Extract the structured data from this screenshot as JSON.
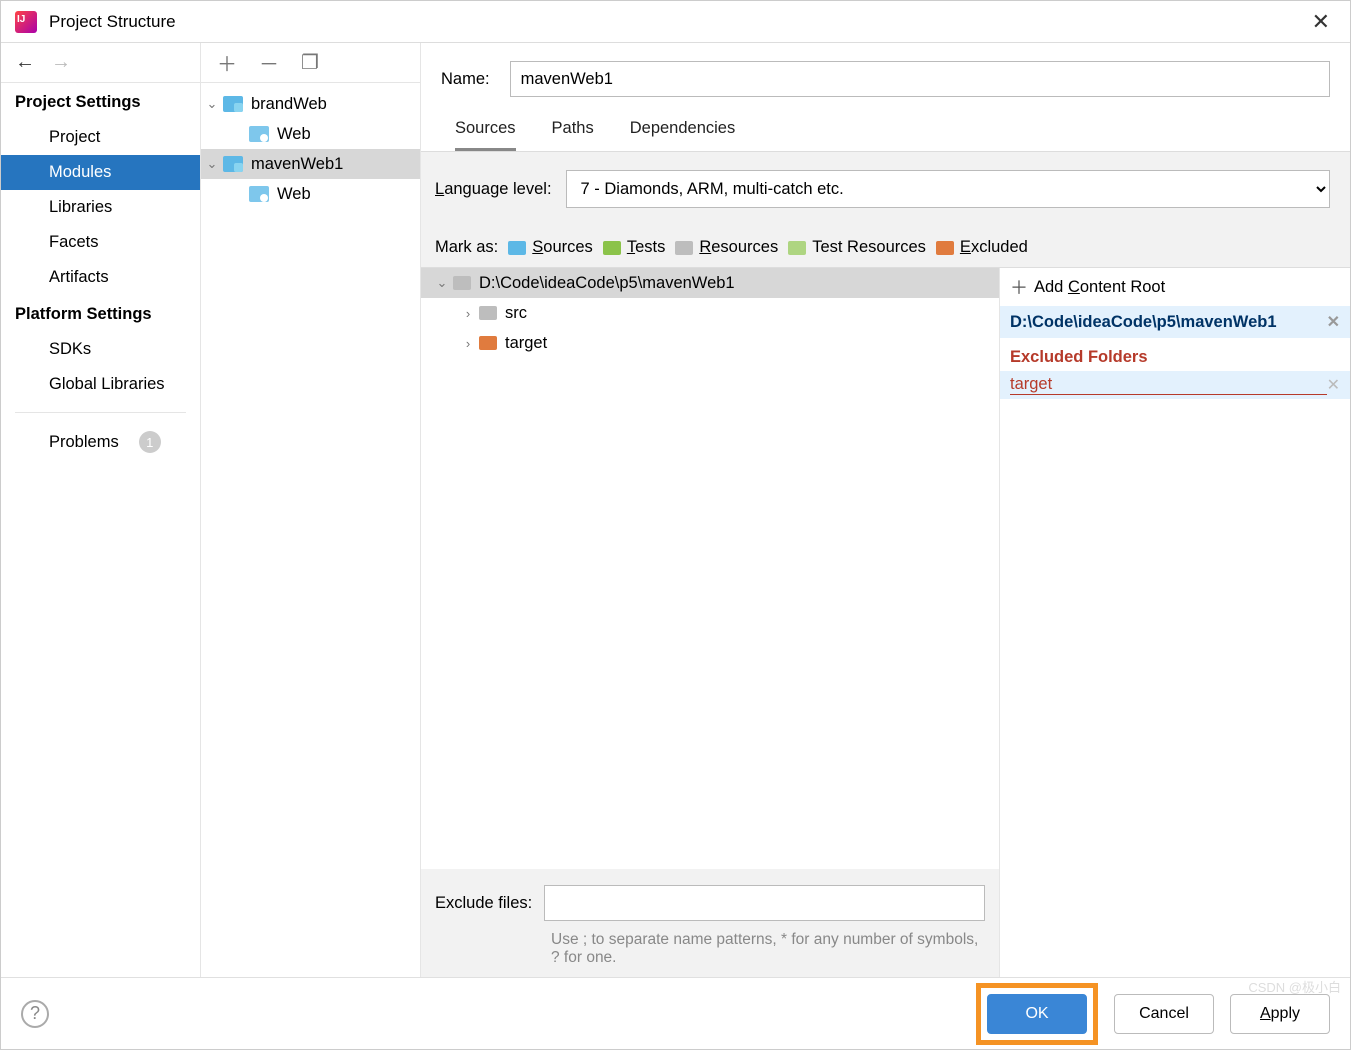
{
  "window": {
    "title": "Project Structure"
  },
  "leftnav": {
    "section1": "Project Settings",
    "items1": [
      "Project",
      "Modules",
      "Libraries",
      "Facets",
      "Artifacts"
    ],
    "section2": "Platform Settings",
    "items2": [
      "SDKs",
      "Global Libraries"
    ],
    "problems": "Problems",
    "problems_count": "1"
  },
  "tree": {
    "modules": [
      {
        "name": "brandWeb",
        "children": [
          "Web"
        ]
      },
      {
        "name": "mavenWeb1",
        "children": [
          "Web"
        ]
      }
    ]
  },
  "content": {
    "name_label": "Name:",
    "name_value": "mavenWeb1",
    "tabs": [
      "Sources",
      "Paths",
      "Dependencies"
    ],
    "lang_label_pre": "L",
    "lang_label_post": "anguage level:",
    "lang_value": "7 - Diamonds, ARM, multi-catch etc.",
    "markas_label": "Mark as:",
    "marks": {
      "sources_pre": "S",
      "sources_post": "ources",
      "tests_pre": "T",
      "tests_post": "ests",
      "resources_pre": "R",
      "resources_post": "esources",
      "tresources": "Test Resources",
      "excluded_pre": "E",
      "excluded_post": "xcluded"
    },
    "root_path": "D:\\Code\\ideaCode\\p5\\mavenWeb1",
    "src_children": [
      {
        "name": "src",
        "color": "gray"
      },
      {
        "name": "target",
        "color": "orange"
      }
    ],
    "exclude_files_label": "Exclude files:",
    "exclude_hint": "Use ; to separate name patterns, * for any number of symbols, ? for one.",
    "right": {
      "add_root_pre": "Add ",
      "add_root_u": "C",
      "add_root_post": "ontent Root",
      "root": "D:\\Code\\ideaCode\\p5\\mavenWeb1",
      "excluded_header": "Excluded Folders",
      "excluded_items": [
        "target"
      ]
    }
  },
  "footer": {
    "ok": "OK",
    "cancel": "Cancel",
    "apply_u": "A",
    "apply_post": "pply"
  },
  "watermark": "CSDN @极小白"
}
